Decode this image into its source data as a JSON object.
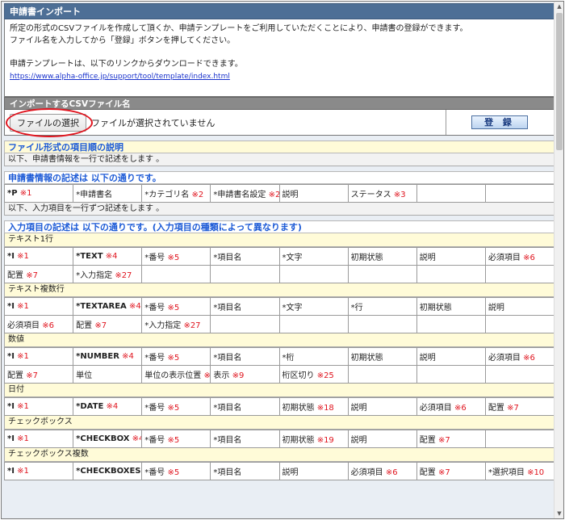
{
  "title": "申請書インポート",
  "description": {
    "line1": "所定の形式のCSVファイルを作成して頂くか、申請テンプレートをご利用していただくことにより、申請書の登録ができます。",
    "line2": "ファイル名を入力してから「登録」ボタンを押してください。",
    "line3": "申請テンプレートは、以下のリンクからダウンロードできます。",
    "link": "https://www.alpha-office.jp/support/tool/template/index.html"
  },
  "csv_section": {
    "header": "インポートするCSVファイル名",
    "file_button": "ファイルの選択",
    "file_status": "ファイルが選択されていません",
    "register_button": "登 録"
  },
  "format_section": {
    "title": "ファイル形式の項目順の説明",
    "note": "以下、申請書情報を一行で記述をします 。"
  },
  "app_info_section": {
    "title": "申請書情報の記述は 以下の通りです。",
    "cells": [
      {
        "label": "*P",
        "note": "※1",
        "bold": true
      },
      {
        "label": "*申請書名",
        "note": ""
      },
      {
        "label": "*カテゴリ名",
        "note": "※2"
      },
      {
        "label": "*申請書名設定",
        "note": "※28"
      },
      {
        "label": "説明",
        "note": ""
      },
      {
        "label": "ステータス",
        "note": "※3"
      },
      {
        "label": "",
        "note": ""
      },
      {
        "label": "",
        "note": ""
      }
    ],
    "note": "以下、入力項目を一行ずつ記述をします 。"
  },
  "input_section": {
    "title": "入力項目の記述は 以下の通りです。(入力項目の種類によって異なります)",
    "types": [
      {
        "name": "テキスト1行",
        "rows": [
          [
            {
              "label": "*I",
              "note": "※1",
              "bold": true
            },
            {
              "label": "*TEXT",
              "note": "※4",
              "bold": true
            },
            {
              "label": "*番号",
              "note": "※5"
            },
            {
              "label": "*項目名",
              "note": ""
            },
            {
              "label": "*文字",
              "note": ""
            },
            {
              "label": "初期状態",
              "note": ""
            },
            {
              "label": "説明",
              "note": ""
            },
            {
              "label": "必須項目",
              "note": "※6"
            }
          ],
          [
            {
              "label": "配置",
              "note": "※7"
            },
            {
              "label": "*入力指定",
              "note": "※27"
            },
            {
              "label": "",
              "note": ""
            },
            {
              "label": "",
              "note": ""
            },
            {
              "label": "",
              "note": ""
            },
            {
              "label": "",
              "note": ""
            },
            {
              "label": "",
              "note": ""
            },
            {
              "label": "",
              "note": ""
            }
          ]
        ]
      },
      {
        "name": "テキスト複数行",
        "rows": [
          [
            {
              "label": "*I",
              "note": "※1",
              "bold": true
            },
            {
              "label": "*TEXTAREA",
              "note": "※4",
              "bold": true
            },
            {
              "label": "*番号",
              "note": "※5"
            },
            {
              "label": "*項目名",
              "note": ""
            },
            {
              "label": "*文字",
              "note": ""
            },
            {
              "label": "*行",
              "note": ""
            },
            {
              "label": "初期状態",
              "note": ""
            },
            {
              "label": "説明",
              "note": ""
            }
          ],
          [
            {
              "label": "必須項目",
              "note": "※6"
            },
            {
              "label": "配置",
              "note": "※7"
            },
            {
              "label": "*入力指定",
              "note": "※27"
            },
            {
              "label": "",
              "note": ""
            },
            {
              "label": "",
              "note": ""
            },
            {
              "label": "",
              "note": ""
            },
            {
              "label": "",
              "note": ""
            },
            {
              "label": "",
              "note": ""
            }
          ]
        ]
      },
      {
        "name": "数値",
        "rows": [
          [
            {
              "label": "*I",
              "note": "※1",
              "bold": true
            },
            {
              "label": "*NUMBER",
              "note": "※4",
              "bold": true
            },
            {
              "label": "*番号",
              "note": "※5"
            },
            {
              "label": "*項目名",
              "note": ""
            },
            {
              "label": "*桁",
              "note": ""
            },
            {
              "label": "初期状態",
              "note": ""
            },
            {
              "label": "説明",
              "note": ""
            },
            {
              "label": "必須項目",
              "note": "※6"
            }
          ],
          [
            {
              "label": "配置",
              "note": "※7"
            },
            {
              "label": "単位",
              "note": ""
            },
            {
              "label": "単位の表示位置",
              "note": "※8"
            },
            {
              "label": "表示",
              "note": "※9"
            },
            {
              "label": "桁区切り",
              "note": "※25"
            },
            {
              "label": "",
              "note": ""
            },
            {
              "label": "",
              "note": ""
            },
            {
              "label": "",
              "note": ""
            }
          ]
        ]
      },
      {
        "name": "日付",
        "rows": [
          [
            {
              "label": "*I",
              "note": "※1",
              "bold": true
            },
            {
              "label": "*DATE",
              "note": "※4",
              "bold": true
            },
            {
              "label": "*番号",
              "note": "※5"
            },
            {
              "label": "*項目名",
              "note": ""
            },
            {
              "label": "初期状態",
              "note": "※18"
            },
            {
              "label": "説明",
              "note": ""
            },
            {
              "label": "必須項目",
              "note": "※6"
            },
            {
              "label": "配置",
              "note": "※7"
            }
          ]
        ]
      },
      {
        "name": "チェックボックス",
        "rows": [
          [
            {
              "label": "*I",
              "note": "※1",
              "bold": true
            },
            {
              "label": "*CHECKBOX",
              "note": "※4",
              "bold": true
            },
            {
              "label": "*番号",
              "note": "※5"
            },
            {
              "label": "*項目名",
              "note": ""
            },
            {
              "label": "初期状態",
              "note": "※19"
            },
            {
              "label": "説明",
              "note": ""
            },
            {
              "label": "配置",
              "note": "※7"
            },
            {
              "label": "",
              "note": ""
            }
          ]
        ]
      },
      {
        "name": "チェックボックス複数",
        "rows": [
          [
            {
              "label": "*I",
              "note": "※1",
              "bold": true
            },
            {
              "label": "*CHECKBOXES",
              "note": "※4",
              "bold": true
            },
            {
              "label": "*番号",
              "note": "※5"
            },
            {
              "label": "*項目名",
              "note": ""
            },
            {
              "label": "説明",
              "note": ""
            },
            {
              "label": "必須項目",
              "note": "※6"
            },
            {
              "label": "配置",
              "note": "※7"
            },
            {
              "label": "*選択項目",
              "note": "※10"
            }
          ]
        ]
      }
    ]
  }
}
